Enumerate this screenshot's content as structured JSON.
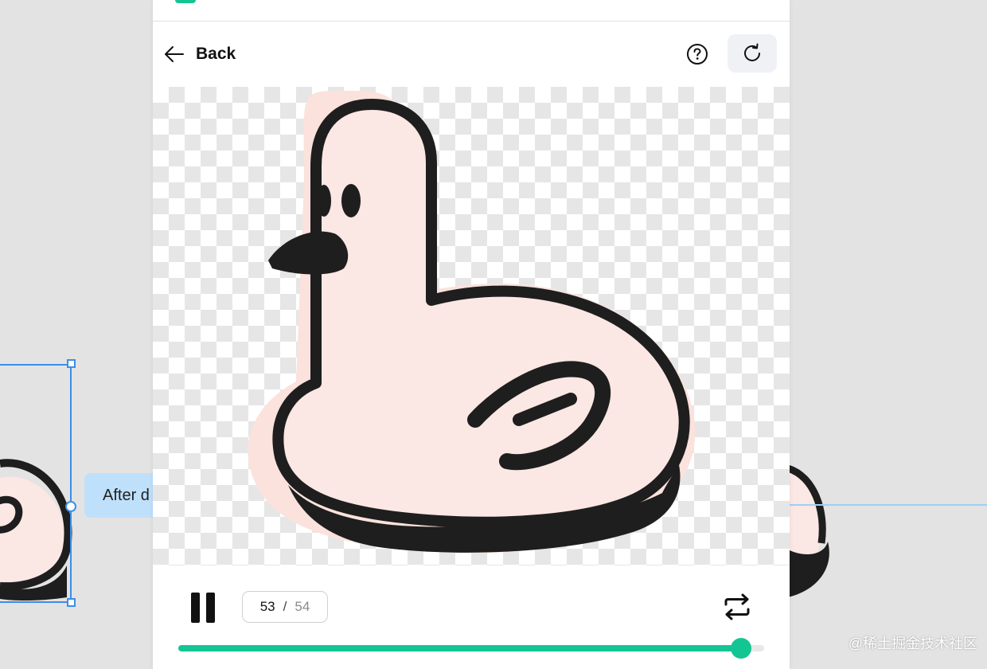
{
  "canvas": {
    "tooltip_text": "After d",
    "watermark": "@稀土掘金技术社区"
  },
  "panel": {
    "back_label": "Back",
    "help_icon": "help-circle-icon",
    "refresh_icon": "refresh-icon"
  },
  "player": {
    "current_frame": "53",
    "separator": "/",
    "total_frames": "54",
    "progress": 0.96,
    "loop_icon": "loop-icon",
    "pause_icon": "pause-icon"
  },
  "colors": {
    "accent": "#14c594",
    "selection": "#3b8ee8",
    "duck_fill": "#fbe7e3",
    "outline": "#1e1e1e"
  }
}
